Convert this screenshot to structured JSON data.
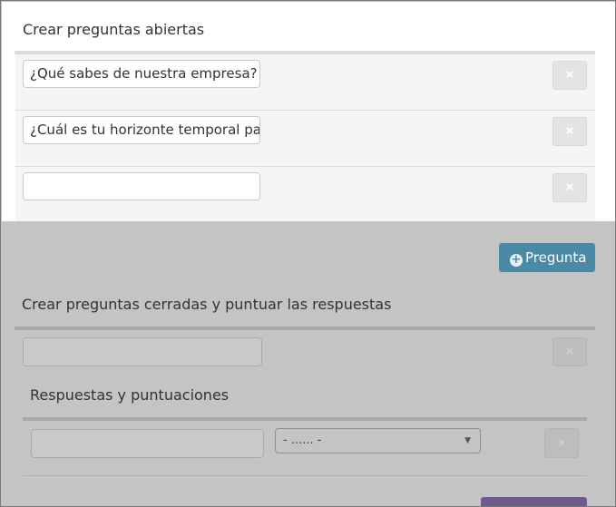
{
  "open_questions": {
    "title": "Crear preguntas abiertas",
    "rows": [
      {
        "value": "¿Qué sabes de nuestra empresa?",
        "remove_icon": "×"
      },
      {
        "value": "¿Cuál es tu horizonte temporal para",
        "remove_icon": "×"
      },
      {
        "value": "",
        "remove_icon": "×"
      }
    ],
    "add_button_label": "Pregunta",
    "add_icon": "+"
  },
  "closed_questions": {
    "title": "Crear preguntas cerradas y puntuar las respuestas",
    "question_value": "",
    "remove_icon": "×",
    "answers_title": "Respuestas y puntuaciones",
    "answer_value": "",
    "score_select": {
      "selected": "- ...... -"
    },
    "answer_remove_icon": "×"
  },
  "colors": {
    "accent_blue": "#4a8aa6",
    "accent_purple": "#6f5a8f",
    "overlay_gray": "#c4c4c4"
  }
}
